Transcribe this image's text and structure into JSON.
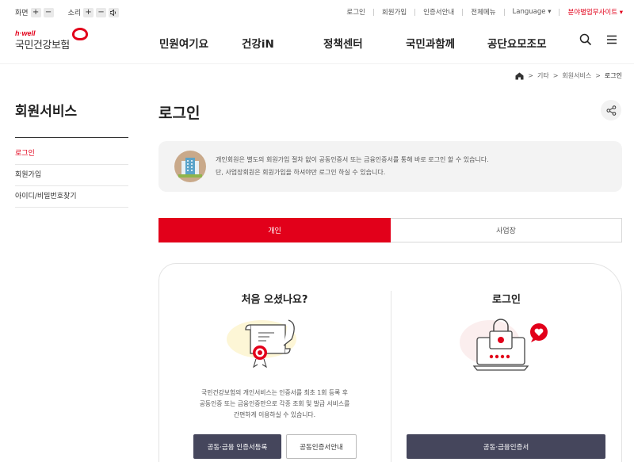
{
  "util": {
    "screen_label": "화면",
    "sound_label": "소리",
    "plus": "+",
    "minus": "−",
    "links": [
      "로그인",
      "회원가입",
      "인증서안내",
      "전체메뉴"
    ],
    "language": "Language ▾",
    "field_site": "분야별업무사이트 ▾"
  },
  "logo": {
    "hwell": "h·well",
    "name": "국민건강보험"
  },
  "gnb": [
    "민원여기요",
    "건강iN",
    "정책센터",
    "국민과함께",
    "공단요모조모"
  ],
  "breadcrumb": {
    "items": [
      "기타",
      "회원서비스"
    ],
    "current": "로그인",
    "sep": ">"
  },
  "side": {
    "title": "회원서비스",
    "items": [
      {
        "label": "로그인",
        "active": true
      },
      {
        "label": "회원가입",
        "active": false
      },
      {
        "label": "아이디/비밀번호찾기",
        "active": false
      }
    ]
  },
  "page": {
    "title": "로그인"
  },
  "notice": {
    "line1": "개인회원은 별도의 회원가입 절차 없이 공동인증서 또는 금융인증서를 통해 바로 로그인 할 수 있습니다.",
    "line2": "단, 사업장회원은 회원가입을 하셔야만 로그인 하실 수 있습니다."
  },
  "tabs": [
    {
      "label": "개인",
      "active": true
    },
    {
      "label": "사업장",
      "active": false
    }
  ],
  "first_visit": {
    "title": "처음 오셨나요?",
    "desc1": "국민건강보험의 개인서비스는 인증서를 최초 1회 등록 후",
    "desc2": "공동인증 또는 금융인증만으로 각종 조회 및 발급 서비스를",
    "desc3": "간편하게 이용하실 수 있습니다.",
    "register_button": "공동·금융 인증서등록",
    "guide_button": "공동인증서안내"
  },
  "login_panel": {
    "title": "로그인",
    "cert_button": "공동·금융인증서"
  },
  "colors": {
    "accent": "#e2001a",
    "dark_button": "#45465c"
  },
  "icons": [
    "plus-icon",
    "minus-icon",
    "speaker-icon",
    "search-icon",
    "menu-icon",
    "home-icon",
    "share-icon",
    "building-icon",
    "certificate-icon",
    "laptop-lock-icon"
  ]
}
